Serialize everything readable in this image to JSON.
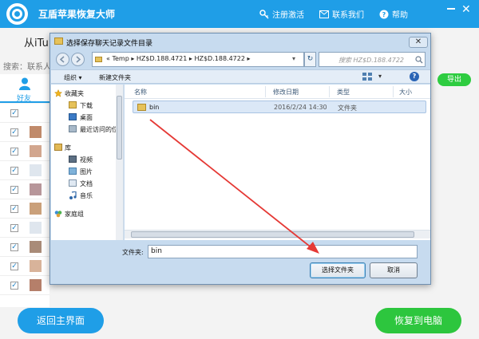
{
  "app": {
    "title": "互盾苹果恢复大师",
    "links": {
      "register": "注册激活",
      "contact": "联系我们",
      "help": "帮助"
    }
  },
  "background": {
    "heading": "从iTu",
    "search_label": "搜索：联系人",
    "tab_friends": "好友",
    "export_label": "导出",
    "home_button": "返回主界面",
    "restore_button": "恢复到电脑"
  },
  "dialog": {
    "title": "选择保存聊天记录文件目录",
    "close": "✕",
    "breadcrumb": [
      "«",
      "Temp",
      "▸",
      "HZ$D.188.4721",
      "▸",
      "HZ$D.188.4722",
      "▸"
    ],
    "search_placeholder": "搜索 HZ$D.188.4722",
    "toolbar": {
      "organize": "组织 ▾",
      "new_folder": "新建文件夹"
    },
    "sidebar": {
      "favorites": "收藏夹",
      "downloads": "下载",
      "desktop": "桌面",
      "recent": "最近访问的位",
      "libraries": "库",
      "videos": "视频",
      "pictures": "图片",
      "documents": "文档",
      "music": "音乐",
      "homegroup": "家庭组"
    },
    "columns": {
      "name": "名称",
      "modified": "修改日期",
      "type": "类型",
      "size": "大小"
    },
    "rows": [
      {
        "name": "bin",
        "modified": "2016/2/24 14:30",
        "type": "文件夹"
      }
    ],
    "filename_label": "文件夹:",
    "filename_value": "bin",
    "select_button": "选择文件夹",
    "cancel_button": "取消"
  },
  "colors": {
    "accent_blue": "#1f9ee7",
    "accent_green": "#2dc63e",
    "annotation_arrow": "#e53935"
  }
}
